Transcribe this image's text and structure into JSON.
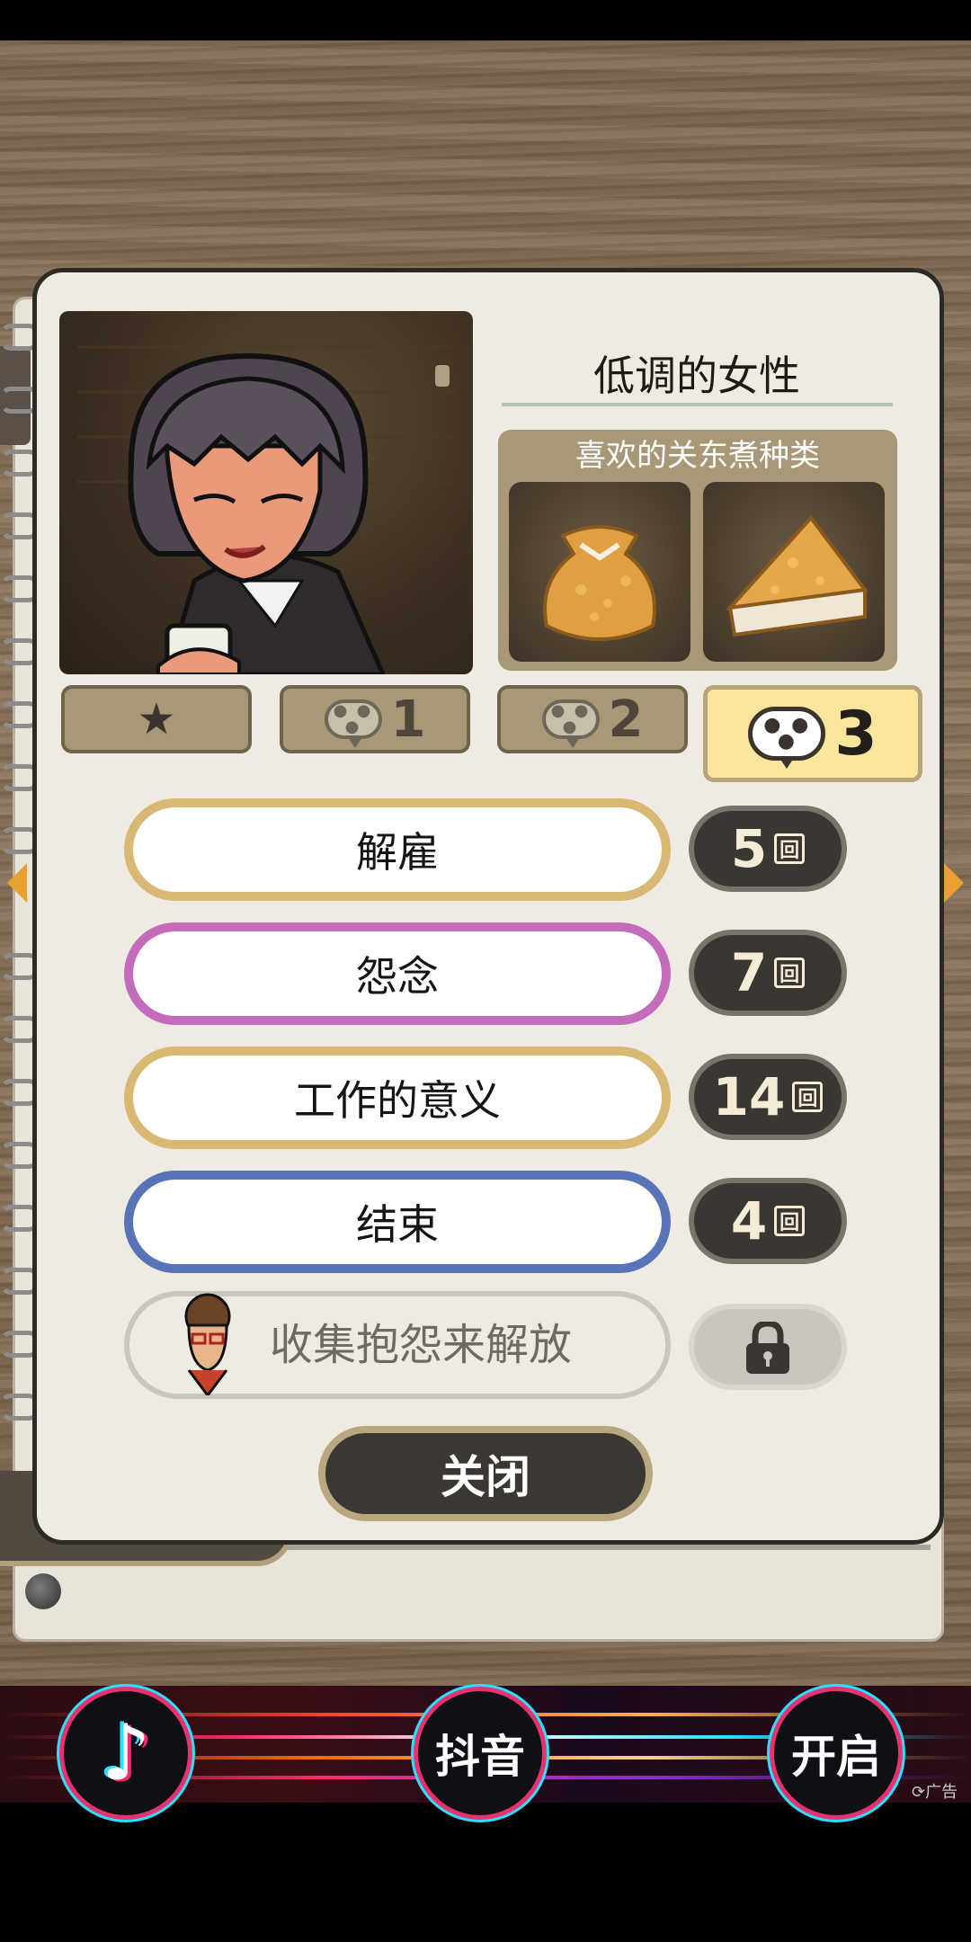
{
  "character": {
    "name": "低调的女性",
    "favorite_title": "喜欢的关东煮种类",
    "favorite_items": [
      "mochi-pouch-kinchaku",
      "fried-tofu-triangle"
    ]
  },
  "chapter_tabs": [
    {
      "label": "",
      "icon": "star-icon",
      "active": false
    },
    {
      "label": "1",
      "icon": "speech-bubble-icon",
      "active": false
    },
    {
      "label": "2",
      "icon": "speech-bubble-icon",
      "active": false
    },
    {
      "label": "3",
      "icon": "speech-bubble-icon",
      "active": true
    }
  ],
  "options": [
    {
      "label": "解雇",
      "count": "5",
      "unit": "回",
      "border_color": "#d9b873"
    },
    {
      "label": "怨念",
      "count": "7",
      "unit": "回",
      "border_color": "#c46bbb"
    },
    {
      "label": "工作的意义",
      "count": "14",
      "unit": "回",
      "border_color": "#d9b873"
    },
    {
      "label": "结束",
      "count": "4",
      "unit": "回",
      "border_color": "#5873b8"
    }
  ],
  "locked_option": {
    "label": "收集抱怨来解放",
    "icon": "lock-icon"
  },
  "close_label": "关闭",
  "ad_banner": {
    "buttons": [
      "",
      "抖音",
      "开启"
    ],
    "ad_tag": "广告"
  }
}
